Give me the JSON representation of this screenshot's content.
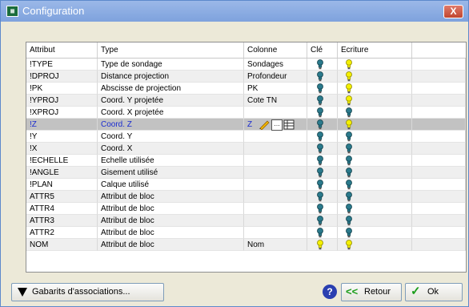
{
  "window": {
    "title": "Configuration",
    "app_icon": "app-icon",
    "close_label": "X"
  },
  "columns": [
    "Attribut",
    "Type",
    "Colonne",
    "Clé",
    "Ecriture"
  ],
  "rows": [
    {
      "attribut": "!TYPE",
      "type": "Type de sondage",
      "colonne": "Sondages",
      "cle": "teal",
      "ecriture": "yellow"
    },
    {
      "attribut": "!DPROJ",
      "type": "Distance projection",
      "colonne": "Profondeur",
      "cle": "teal",
      "ecriture": "yellow"
    },
    {
      "attribut": "!PK",
      "type": "Abscisse de projection",
      "colonne": "PK",
      "cle": "teal",
      "ecriture": "yellow"
    },
    {
      "attribut": "!YPROJ",
      "type": "Coord. Y projetée",
      "colonne": "Cote TN",
      "cle": "teal",
      "ecriture": "yellow"
    },
    {
      "attribut": "!XPROJ",
      "type": "Coord. X projetée",
      "colonne": "",
      "cle": "teal",
      "ecriture": "teal"
    },
    {
      "attribut": "!Z",
      "type": "Coord. Z",
      "colonne": "Z",
      "cle": "teal",
      "ecriture": "yellow",
      "selected": true
    },
    {
      "attribut": "!Y",
      "type": "Coord. Y",
      "colonne": "",
      "cle": "teal",
      "ecriture": "teal"
    },
    {
      "attribut": "!X",
      "type": "Coord. X",
      "colonne": "",
      "cle": "teal",
      "ecriture": "teal"
    },
    {
      "attribut": "!ECHELLE",
      "type": "Echelle utilisée",
      "colonne": "",
      "cle": "teal",
      "ecriture": "teal"
    },
    {
      "attribut": "!ANGLE",
      "type": "Gisement utilisé",
      "colonne": "",
      "cle": "teal",
      "ecriture": "teal"
    },
    {
      "attribut": "!PLAN",
      "type": "Calque utilisé",
      "colonne": "",
      "cle": "teal",
      "ecriture": "teal"
    },
    {
      "attribut": "ATTR5",
      "type": "Attribut de bloc",
      "colonne": "",
      "cle": "teal",
      "ecriture": "teal"
    },
    {
      "attribut": "ATTR4",
      "type": "Attribut de bloc",
      "colonne": "",
      "cle": "teal",
      "ecriture": "teal"
    },
    {
      "attribut": "ATTR3",
      "type": "Attribut de bloc",
      "colonne": "",
      "cle": "teal",
      "ecriture": "teal"
    },
    {
      "attribut": "ATTR2",
      "type": "Attribut de bloc",
      "colonne": "",
      "cle": "teal",
      "ecriture": "teal"
    },
    {
      "attribut": "NOM",
      "type": "Attribut de bloc",
      "colonne": "Nom",
      "cle": "yellow",
      "ecriture": "yellow"
    }
  ],
  "buttons": {
    "gabarits": "Gabarits d'associations...",
    "retour": "Retour",
    "ok": "Ok"
  },
  "colors": {
    "bulb_teal": "#2b7a8c",
    "bulb_yellow": "#f4f000",
    "selected_text": "#1a2bd0",
    "title_bar": "#8aaae2"
  }
}
